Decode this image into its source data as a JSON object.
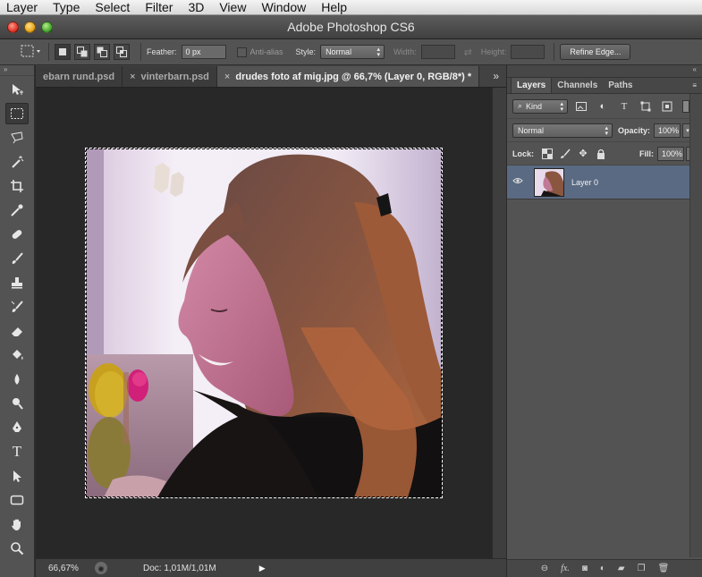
{
  "menubar": {
    "items": [
      "Layer",
      "Type",
      "Select",
      "Filter",
      "3D",
      "View",
      "Window",
      "Help"
    ]
  },
  "window": {
    "title": "Adobe Photoshop CS6"
  },
  "options": {
    "feather_label": "Feather:",
    "feather_value": "0 px",
    "antialias_label": "Anti-alias",
    "style_label": "Style:",
    "style_value": "Normal",
    "width_label": "Width:",
    "height_label": "Height:",
    "refine_edge_label": "Refine Edge..."
  },
  "tabs": [
    {
      "label": "ebarn rund.psd",
      "close": "×"
    },
    {
      "label": "vinterbarn.psd",
      "close": "×"
    },
    {
      "label": "drudes foto af mig.jpg @ 66,7% (Layer 0, RGB/8*) *",
      "close": "×"
    }
  ],
  "tabs_more": "»",
  "status": {
    "zoom": "66,67%",
    "doc": "Doc: 1,01M/1,01M"
  },
  "panel": {
    "tabs": [
      "Layers",
      "Channels",
      "Paths"
    ],
    "kind_label": "Kind",
    "blend_mode": "Normal",
    "opacity_label": "Opacity:",
    "opacity_value": "100%",
    "lock_label": "Lock:",
    "fill_label": "Fill:",
    "fill_value": "100%",
    "layers": [
      {
        "name": "Layer 0",
        "visible": true
      }
    ]
  },
  "colors": {
    "panel_bg": "#535353",
    "canvas_bg": "#282828",
    "layer_selected": "#5a6a82"
  },
  "tools": [
    "move-tool-icon",
    "rectangular-marquee-icon",
    "lasso-icon",
    "magic-wand-icon",
    "crop-icon",
    "eyedropper-icon",
    "healing-brush-icon",
    "brush-icon",
    "clone-stamp-icon",
    "history-brush-icon",
    "eraser-icon",
    "paint-bucket-icon",
    "blur-icon",
    "dodge-icon",
    "pen-icon",
    "type-icon",
    "path-selection-icon",
    "shape-icon",
    "hand-icon",
    "zoom-icon"
  ]
}
